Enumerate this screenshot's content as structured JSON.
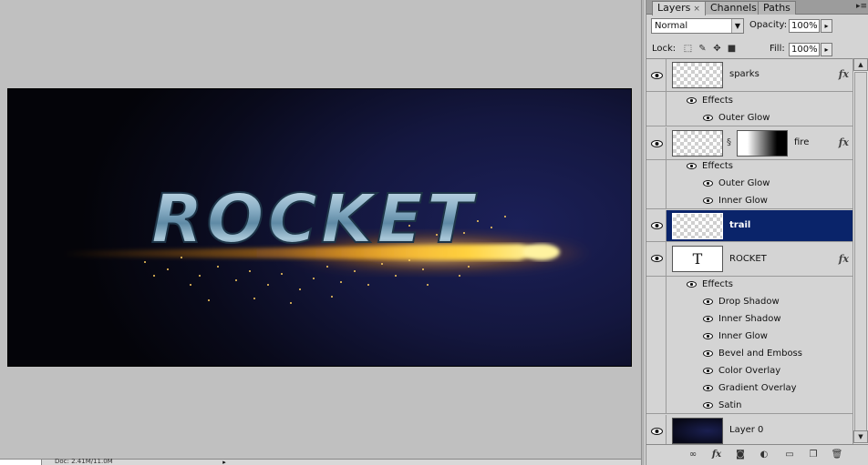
{
  "panel": {
    "tabs": [
      {
        "label": "Layers",
        "close": "×"
      },
      {
        "label": "Channels"
      },
      {
        "label": "Paths"
      }
    ],
    "menu_icon": "▸≡",
    "blend_mode": "Normal",
    "opacity_label": "Opacity:",
    "opacity_value": "100%",
    "lock_label": "Lock:",
    "fill_label": "Fill:",
    "fill_value": "100%"
  },
  "layers": [
    {
      "name": "sparks",
      "fx": "fx",
      "effects_label": "Effects",
      "effects": [
        "Outer Glow"
      ]
    },
    {
      "name": "fire",
      "fx": "fx",
      "effects_label": "Effects",
      "effects": [
        "Outer Glow",
        "Inner Glow"
      ]
    },
    {
      "name": "trail",
      "selected": true
    },
    {
      "name": "ROCKET",
      "thumb_text": "T",
      "fx": "fx",
      "effects_label": "Effects",
      "effects": [
        "Drop Shadow",
        "Inner Shadow",
        "Inner Glow",
        "Bevel and Emboss",
        "Color Overlay",
        "Gradient Overlay",
        "Satin"
      ]
    },
    {
      "name": "Layer 0"
    }
  ],
  "canvas": {
    "text": "ROCKET"
  },
  "status": {
    "doc_info": "Doc: 2.41M/11.0M"
  },
  "footer_icons": [
    "link-layers-icon",
    "fx-style-icon",
    "mask-icon",
    "adjustment-icon",
    "group-folder-icon",
    "new-layer-icon",
    "trash-icon"
  ],
  "colors": {
    "selected_row": "#0a246a",
    "panel_bg": "#d4d4d4",
    "workspace_bg": "#c0c0c0"
  }
}
